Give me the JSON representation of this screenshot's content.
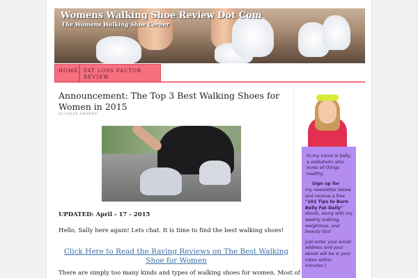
{
  "header": {
    "site_title": "Womens Walking Shoe Review Dot Com",
    "tagline": "The Womens Walking Shoe Corner"
  },
  "nav": {
    "items": [
      {
        "label": "HOME"
      },
      {
        "label": "FAT LOSS FACTOR REVIEW"
      }
    ]
  },
  "post": {
    "title": "Announcement: The Top 3 Best Walking Shoes for Women in 2015",
    "byline_prefix": "by",
    "author": "SALLY SHOERU",
    "updated": "UPDATED: April - 17 - 2015",
    "intro": "Hello, Sally here again!  Lets chat.  It is time to find the best walking shoes!",
    "cta_link": "Click Here to Read the Raving Reviews on The Best Walking Shoe for Women",
    "para": "There are simply too many kinds and types of walking shoes for women. Most of them"
  },
  "sidebar": {
    "intro": "Hi,my name is Sally, a walkaholic who loves all things healthy.",
    "signup_bold": "Sign up for",
    "signup_text": "my newsletter below and receive a free",
    "ebook_title": "\"101 Tips to Burn Belly Fat Daily\"",
    "ebook_text": "ebook, along with my weekly",
    "tips_italic": "walking, weightloss, and beauty tips",
    "tips_end": "!",
    "closing": "Just enter your email address and your ebook will be in your inbox within minutes:)"
  }
}
